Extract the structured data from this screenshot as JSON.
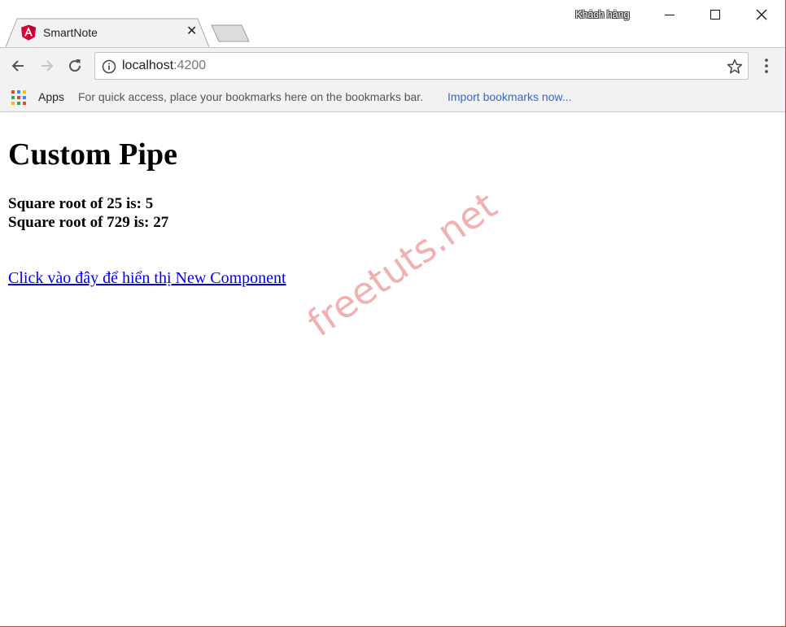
{
  "window": {
    "profile_label": "Khách hàng"
  },
  "tab": {
    "title": "SmartNote",
    "close_glyph": "✕"
  },
  "toolbar": {
    "url_host": "localhost",
    "url_port": ":4200"
  },
  "bookmarks": {
    "apps_label": "Apps",
    "hint": "For quick access, place your bookmarks here on the bookmarks bar.",
    "import_link": "Import bookmarks now..."
  },
  "page": {
    "title": "Custom Pipe",
    "line1": "Square root of 25 is: 5",
    "line2": "Square root of 729 is: 27",
    "link": "Click vào đây để hiển thị New Component",
    "watermark": "freetuts.net"
  },
  "colors": {
    "link": "#0000ee",
    "bookmark_link": "#3367d6",
    "angular_red": "#dd0031",
    "watermark": "#e14646"
  },
  "icons": [
    "angular-icon",
    "close-icon",
    "back-arrow-icon",
    "forward-arrow-icon",
    "reload-icon",
    "info-icon",
    "star-icon",
    "more-vert-icon",
    "apps-grid-icon",
    "minimize-icon",
    "maximize-icon"
  ]
}
